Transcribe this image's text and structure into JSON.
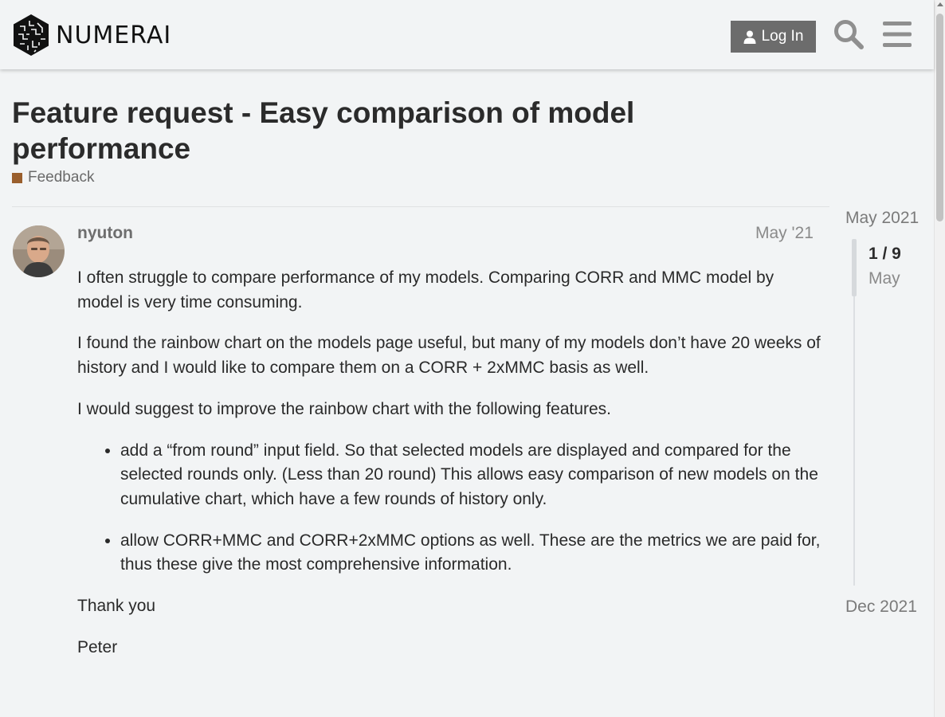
{
  "header": {
    "brand": "NUMERAI",
    "login_label": "Log In",
    "icons": [
      "logo-icon",
      "user-icon",
      "search-icon",
      "hamburger-menu-icon"
    ]
  },
  "topic": {
    "title": "Feature request - Easy comparison of model performance",
    "category": "Feedback",
    "category_color": "#9a5f2d"
  },
  "post": {
    "username": "nyuton",
    "date": "May '21",
    "paragraphs": [
      "I often struggle to compare performance of my models. Comparing CORR and MMC model by model is very time consuming.",
      "I found the rainbow chart on the models page useful, but many of my models don’t have 20 weeks of history and I would like to compare them on a CORR + 2xMMC basis as well.",
      "I would suggest to improve the rainbow chart with the following features."
    ],
    "bullets": [
      "add a “from round” input field. So that selected models are displayed and compared for the selected rounds only. (Less than 20 round) This allows easy comparison of new models on the cumulative chart, which have a few rounds of history only.",
      "allow CORR+MMC and CORR+2xMMC options as well. These are the metrics we are paid for, thus these give the most comprehensive information."
    ],
    "closing": "Thank you",
    "signature": "Peter"
  },
  "timeline": {
    "start_label": "May 2021",
    "position": "1 / 9",
    "current_month": "May",
    "end_label": "Dec 2021"
  }
}
